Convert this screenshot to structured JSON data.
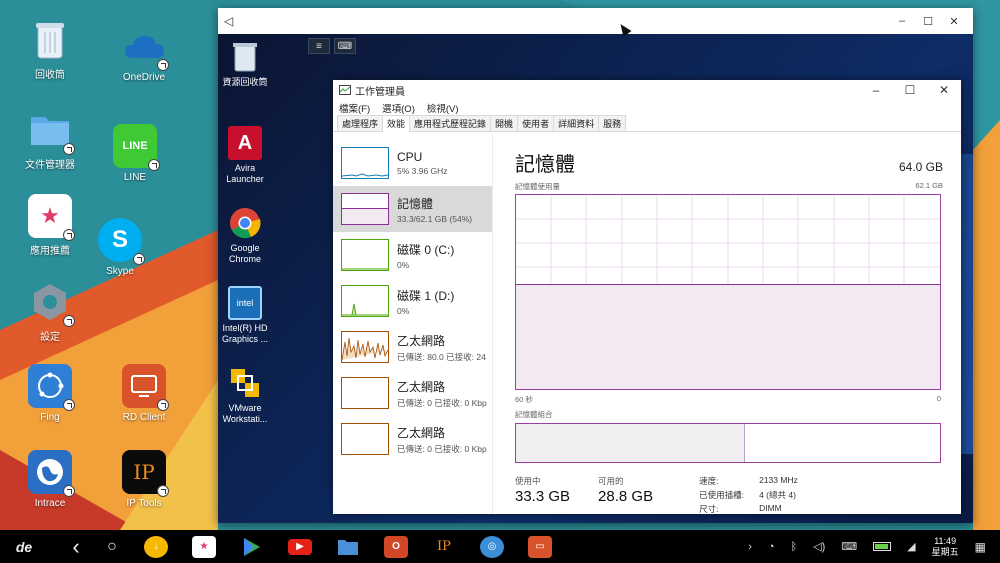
{
  "desktop": {
    "icons": [
      {
        "label": "回收筒",
        "icon": "recycle-bin-icon"
      },
      {
        "label": "OneDrive",
        "icon": "onedrive-icon"
      },
      {
        "label": "文件管理器",
        "icon": "folder-icon"
      },
      {
        "label": "LINE",
        "icon": "line-icon"
      },
      {
        "label": "應用推薦",
        "icon": "store-icon"
      },
      {
        "label": "Skype",
        "icon": "skype-icon"
      },
      {
        "label": "設定",
        "icon": "settings-icon"
      },
      {
        "label": "Fing",
        "icon": "fing-icon"
      },
      {
        "label": "RD Client",
        "icon": "rd-client-icon"
      },
      {
        "label": "Intrace",
        "icon": "intrace-icon"
      },
      {
        "label": "IP Tools",
        "icon": "ip-tools-icon"
      }
    ],
    "ip_text": "IP"
  },
  "remote_window": {
    "back_glyph": "◁",
    "controls": [
      "–",
      "☐",
      "✕"
    ],
    "toolbar": [
      "≡",
      "⌨"
    ],
    "desktop_icons": [
      {
        "label": "資源回收筒",
        "icon": "recycle-bin-icon"
      },
      {
        "label": "Avira Launcher",
        "icon": "avira-icon"
      },
      {
        "label": "Google Chrome",
        "icon": "chrome-icon"
      },
      {
        "label": "Intel(R) HD Graphics ...",
        "icon": "intel-graphics-icon"
      },
      {
        "label": "VMware Workstati...",
        "icon": "vmware-icon"
      }
    ]
  },
  "task_manager": {
    "title": "工作管理員",
    "controls": [
      "–",
      "☐",
      "✕"
    ],
    "menu": [
      "檔案(F)",
      "選項(O)",
      "檢視(V)"
    ],
    "tabs": [
      "處理程序",
      "效能",
      "應用程式歷程記錄",
      "開機",
      "使用者",
      "詳細資料",
      "服務"
    ],
    "active_tab": 1,
    "resources": [
      {
        "name": "CPU",
        "sub": "5% 3.96 GHz",
        "color": "#117dbb"
      },
      {
        "name": "記憶體",
        "sub": "33.3/62.1 GB (54%)",
        "color": "#8b2f97",
        "selected": true
      },
      {
        "name": "磁碟 0 (C:)",
        "sub": "0%",
        "color": "#4da60c"
      },
      {
        "name": "磁碟 1 (D:)",
        "sub": "0%",
        "color": "#4da60c"
      },
      {
        "name": "乙太網路",
        "sub": "已傳送: 80.0 已接收: 24",
        "color": "#a74f01"
      },
      {
        "name": "乙太網路",
        "sub": "已傳送: 0 已接收: 0 Kbp",
        "color": "#a74f01"
      },
      {
        "name": "乙太網路",
        "sub": "已傳送: 0 已接收: 0 Kbp",
        "color": "#a74f01"
      }
    ],
    "memory": {
      "heading": "記憶體",
      "capacity": "64.0 GB",
      "usage_label": "記憶體使用量",
      "usage_max": "62.1 GB",
      "axis_left": "60 秒",
      "axis_right": "0",
      "usage_fraction": 0.54,
      "composition_label": "記憶體組合",
      "composition_fraction": 0.54,
      "in_use_label": "使用中",
      "in_use_value": "33.3 GB",
      "available_label": "可用的",
      "available_value": "28.8 GB",
      "details": [
        {
          "k": "速度:",
          "v": "2133 MHz"
        },
        {
          "k": "已使用插槽:",
          "v": "4 (總共 4)"
        },
        {
          "k": "尺寸:",
          "v": "DIMM"
        }
      ]
    }
  },
  "taskbar": {
    "launcher_glyph": "de",
    "nav": [
      "‹",
      "○"
    ],
    "apps": [
      {
        "icon": "download-icon",
        "color": "#f5b800"
      },
      {
        "icon": "store-icon",
        "color": "#ffffff"
      },
      {
        "icon": "play-store-icon",
        "color": "#ffffff"
      },
      {
        "icon": "youtube-icon",
        "color": "#e62117"
      },
      {
        "icon": "folder-icon",
        "color": "#4a90d9"
      },
      {
        "icon": "office-icon",
        "color": "#d24726"
      },
      {
        "icon": "ip-tools-icon",
        "color": "#000000"
      },
      {
        "icon": "fing-icon",
        "color": "#3c8ed9"
      },
      {
        "icon": "rd-client-icon",
        "color": "#d9532a"
      }
    ],
    "ip_glyph": "IP",
    "time": "11:49",
    "day": "星期五"
  }
}
